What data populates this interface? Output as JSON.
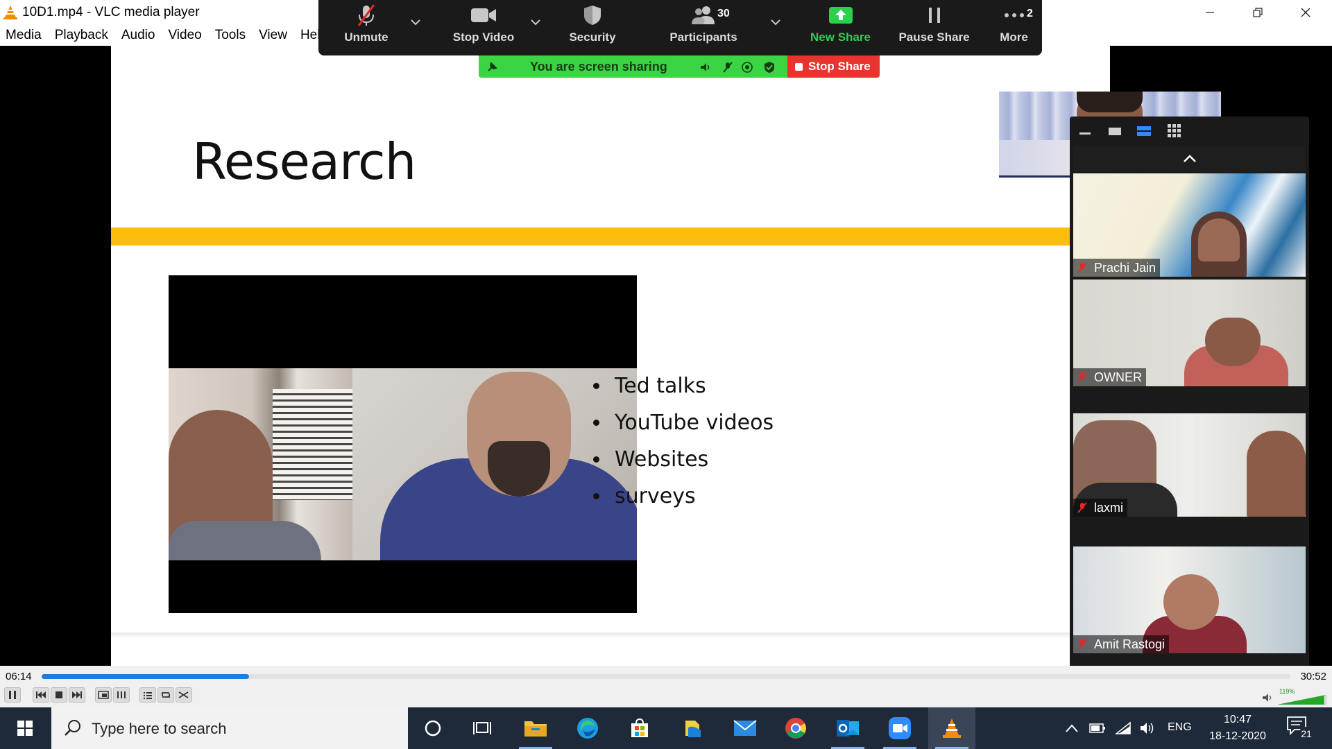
{
  "window": {
    "title": "10D1.mp4 - VLC media player",
    "controls": [
      "minimize",
      "restore",
      "close"
    ]
  },
  "menu": [
    "Media",
    "Playback",
    "Audio",
    "Video",
    "Tools",
    "View",
    "Help"
  ],
  "zoom_toolbar": {
    "unmute": "Unmute",
    "stop_video": "Stop Video",
    "security": "Security",
    "participants": "Participants",
    "participants_count": "30",
    "new_share": "New Share",
    "pause_share": "Pause Share",
    "more": "More",
    "more_badge": "2"
  },
  "share_banner": {
    "text": "You are screen sharing",
    "stop_share": "Stop Share"
  },
  "slide": {
    "title": "Research",
    "bullets": [
      "Ted talks",
      "YouTube videos",
      "Websites",
      "surveys"
    ]
  },
  "gallery": {
    "participants": [
      "Prachi Jain",
      "OWNER",
      "laxmi",
      "Amit Rastogi"
    ]
  },
  "player": {
    "time_elapsed": "06:14",
    "time_total": "30:52",
    "progress": 0.166,
    "volume": "119%",
    "volume_level": 1.19
  },
  "taskbar": {
    "search_placeholder": "Type here to search",
    "apps": [
      "cortana-icon",
      "task-view-icon",
      "file-explorer-icon",
      "edge-icon",
      "store-icon",
      "files-icon",
      "mail-icon",
      "chrome-icon",
      "outlook-icon",
      "zoom-icon",
      "vlc-icon"
    ],
    "language": "ENG",
    "time": "10:47",
    "date": "18-12-2020",
    "notifications": "21"
  },
  "colors": {
    "slide_accent": "#fbbd0e",
    "share_green": "#3bd442",
    "stop_red": "#e8332f",
    "new_share_green": "#2bd14d",
    "seek_blue": "#1f7bdc",
    "taskbar": "#1e2a3a"
  }
}
